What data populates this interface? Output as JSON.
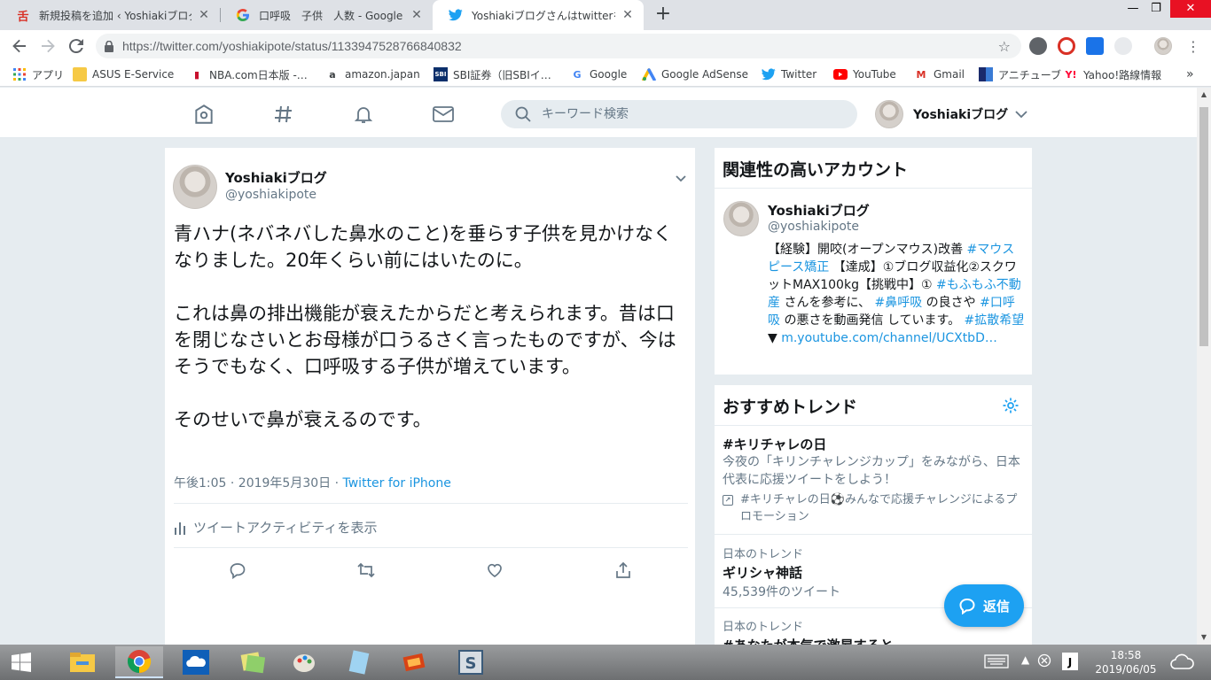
{
  "browser": {
    "tabs": [
      {
        "title": "新規投稿を追加 ‹ Yoshiakiブログ",
        "favicon": "wordpress-icon",
        "color": "#d93025"
      },
      {
        "title": "口呼吸　子供　人数 - Google 検索",
        "favicon": "google-icon",
        "color": "#4285f4"
      },
      {
        "title": "Yoshiakiブログさんはtwitterを使っています",
        "favicon": "twitter-icon",
        "color": "#1da1f2"
      }
    ],
    "url": "https://twitter.com/yoshiakipote/status/1133947528766840832",
    "bookmarks": [
      "アプリ",
      "ASUS E-Service",
      "NBA.com日本版 -…",
      "amazon.japan",
      "SBI証券（旧SBIイ…",
      "Google",
      "Google AdSense",
      "Twitter",
      "YouTube",
      "Gmail",
      "アニチューブ",
      "Yahoo!路線情報"
    ]
  },
  "nav": {
    "search_placeholder": "キーワード検索",
    "user_name": "Yoshiakiブログ"
  },
  "tweet": {
    "user_name": "Yoshiakiブログ",
    "handle": "@yoshiakipote",
    "text": "青ハナ(ネバネバした鼻水のこと)を垂らす子供を見かけなくなりました。20年くらい前にはいたのに。\n\nこれは鼻の排出機能が衰えたからだと考えられます。昔は口を閉じなさいとお母様が口うるさく言ったものですが、今はそうでもなく、口呼吸する子供が増えています。\n\nそのせいで鼻が衰えるのです。",
    "time": "午後1:05 · 2019年5月30日 · ",
    "source": "Twitter for iPhone",
    "activity": "ツイートアクティビティを表示"
  },
  "related": {
    "header": "関連性の高いアカウント",
    "user_name": "Yoshiakiブログ",
    "handle": "@yoshiakipote",
    "bio": [
      {
        "t": "【経験】開咬(オープンマウス)改善 ",
        "h": false
      },
      {
        "t": "#マウスピース矯正",
        "h": true
      },
      {
        "t": " 【達成】①ブログ収益化②スクワットMAX100kg【挑戦中】① ",
        "h": false
      },
      {
        "t": "#もふもふ不動産",
        "h": true
      },
      {
        "t": " さんを参考に、 ",
        "h": false
      },
      {
        "t": "#鼻呼吸",
        "h": true
      },
      {
        "t": " の良さや ",
        "h": false
      },
      {
        "t": "#口呼吸",
        "h": true
      },
      {
        "t": " の悪さを動画発信 しています。 ",
        "h": false
      },
      {
        "t": "#拡散希望",
        "h": true
      },
      {
        "t": " ▼ ",
        "h": false
      }
    ],
    "link": "m.youtube.com/channel/UCXtbD…"
  },
  "trends": {
    "header": "おすすめトレンド",
    "items": [
      {
        "name": "#キリチャレの日",
        "desc": "今夜の「キリンチャレンジカップ」をみながら、日本代表に応援ツイートをしよう！",
        "promo": "#キリチャレの日⚽みんなで応援チャレンジによるプロモーション"
      },
      {
        "context": "日本のトレンド",
        "name": "ギリシャ神話",
        "count": "45,539件のツイート"
      },
      {
        "context": "日本のトレンド",
        "name": "#あなたが本気で激昂すると"
      }
    ]
  },
  "reply_button": "返信",
  "taskbar": {
    "time": "18:58",
    "date": "2019/06/05"
  },
  "colors": {
    "accent": "#1da1f2",
    "link": "#1b95e0"
  }
}
